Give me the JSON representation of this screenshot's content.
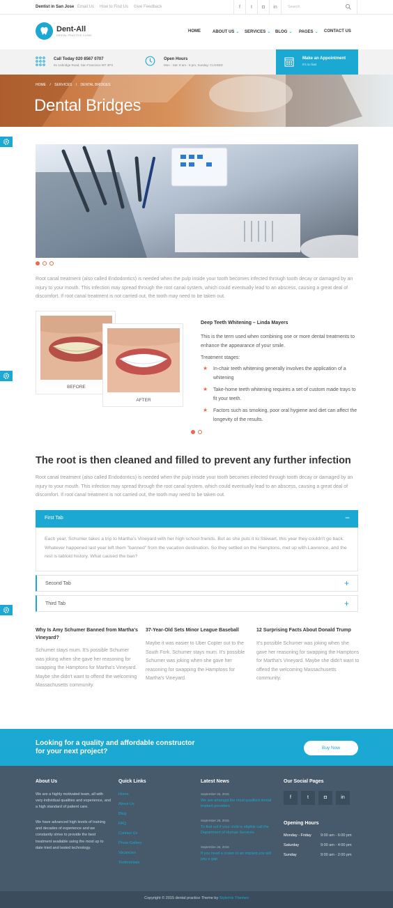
{
  "topbar": {
    "city": "Dentist in San Jose",
    "links": [
      "Email Us",
      "How to Find Us",
      "Give Feedback"
    ],
    "social_icons": [
      "facebook-icon",
      "twitter-icon",
      "instagram-icon",
      "linkedin-icon"
    ],
    "social_glyphs": [
      "f",
      "t",
      "◘",
      "in"
    ],
    "search_placeholder": "Search"
  },
  "brand": {
    "name": "Dent-All",
    "tagline": "DENTAL PRACTICE CLINIC"
  },
  "nav": [
    {
      "label": "HOME",
      "dropdown": false
    },
    {
      "label": "ABOUT US",
      "dropdown": true
    },
    {
      "label": "SERVICES",
      "dropdown": true
    },
    {
      "label": "BLOG",
      "dropdown": true
    },
    {
      "label": "PAGES",
      "dropdown": true
    },
    {
      "label": "CONTACT US",
      "dropdown": false
    }
  ],
  "infobar": {
    "call_title": "Call Today 020 8567 0707",
    "call_sub": "51 Uxbridge Road, San Francisco W7 3PX",
    "hours_title": "Open Hours",
    "hours_sub": "Mon - Sat: 8 am - 5 pm, Sunday: CLOSED",
    "appt_title": "Make an Appointment",
    "appt_sub": "It's so fast"
  },
  "breadcrumb": [
    "HOME",
    "SERVICES",
    "DENTAL BRIDGES"
  ],
  "breadcrumb_sep": "/",
  "page_title": "Dental Bridges",
  "intro": "Root canal treatment (also called Endodontics) is needed when the pulp inside your tooth becomes infected through tooth decay or damaged by an injury to your mouth. This infection may spread through the root canal system, which could eventually lead to an abscess, causing a great deal of discomfort. If root canal treatment is not carried out, the tooth may need to be taken out.",
  "before_label": "BEFORE",
  "after_label": "AFTER",
  "testimonial": {
    "title": "Deep Teeth Whitening – Linda Mayers",
    "text": "This is the term used when combining one or more dental treatments to enhance the appearance of your smile.",
    "stages_label": "Treatment stages:",
    "stages": [
      "In-chair teeth whitening generally involves the application of a whitening",
      "Take-home teeth whitening requires a set of custom made trays to fit your teeth.",
      "Factors such as smoking, poor oral hygiene and diet can affect the longevity of the results."
    ]
  },
  "section_heading": "The root is then cleaned and filled to prevent any further infection",
  "section_text": "Root canal treatment (also called Endodontics) is needed when the pulp inside your tooth becomes infected through tooth decay or damaged by an injury to your mouth. This infection may spread through the root canal system, which could eventually lead to an abscess, causing a great deal of discomfort. If root canal treatment is not carried out, the tooth may need to be taken out.",
  "tabs": [
    {
      "label": "First Tab",
      "open": true,
      "content": "Each year, Schumer takes a trip to Martha's Vineyard with her high school friends. But as she puts it to Stewart, this year they couldn't go back. Whatever happened last year left them \"banned\" from the vacation destination. So they settled on the Hamptons, met up with Lawrence, and the rest is tabloid history. What caused the ban?"
    },
    {
      "label": "Second Tab",
      "open": false
    },
    {
      "label": "Third Tab",
      "open": false
    }
  ],
  "tab_open_symbol": "−",
  "tab_closed_symbol": "+",
  "posts": [
    {
      "title": "Why Is Amy Schumer Banned from Martha's Vineyard?",
      "text": "Schumer stays mum. It's possible Schumer was joking when she gave her reasoning for swapping the Hamptons for Martha's Vineyard. Maybe she didn't want to offend the welcoming Massachusetts community."
    },
    {
      "title": "37-Year-Old Sets Minor League Baseball",
      "text": "Maybe it was easier to Uber Copter out to the South Fork. Schumer stays mum. It's possible Schumer was joking when she gave her reasoning for swapping the Hamptons for Martha's Vineyard."
    },
    {
      "title": "12 Surprising Facts About Donald Trump",
      "text": "It's possible Schumer was joking when she gave her reasoning for swapping the Hamptons for Martha's Vineyard. Maybe she didn't want to offend the welcoming Massachusetts community."
    }
  ],
  "cta": {
    "line1": "Looking for a quality and affordable constructor",
    "line2": "for your next project?",
    "button": "Buy Now"
  },
  "footer": {
    "about_title": "About Us",
    "about_p1": "We are a highly motivated team, all with very individual qualities and experience, and a high standard of patient care.",
    "about_p2": "We have advanced high levels of training and decades of experience and we constantly strive to provide the best treatment available using the most up to date tried and tested technology.",
    "quick_title": "Quick Links",
    "quick_links": [
      "Home",
      "About Us",
      "Blog",
      "FAQ",
      "Contact Us",
      "Photo Gallery",
      "Vacancies",
      "Testimonials"
    ],
    "news_title": "Latest News",
    "news": [
      {
        "date": "September 26, 2015",
        "title": "We are amongst the most qualified dental implant providers"
      },
      {
        "date": "September 26, 2015",
        "title": "To find out if your child is eligible call the Department of Human Services"
      },
      {
        "date": "September 26, 2015",
        "title": "If you need a crown or an implant you will pay a gap"
      }
    ],
    "social_title": "Our Social Pages",
    "hours_title": "Opening Hours",
    "hours": [
      {
        "day": "Monday - Friday",
        "time": "9:00 am - 6:00 pm"
      },
      {
        "day": "Saturday",
        "time": "9:00 am - 4:00 pm"
      },
      {
        "day": "Sunday",
        "time": "9:00 am - 2:00 pm"
      }
    ],
    "copyright": "Copyright © 2015 dental practice Theme by",
    "copyright_link": "Stylemix Themes"
  },
  "colors": {
    "accent": "#1ba8d2",
    "star": "#e86c4c",
    "footer_bg": "#465a6b",
    "bottom_bg": "#3b4d5c"
  }
}
